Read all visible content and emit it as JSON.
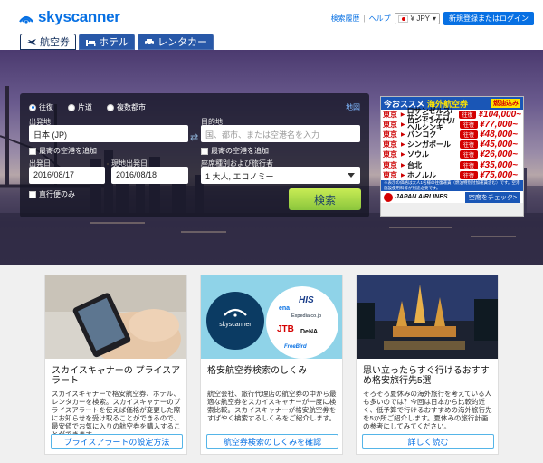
{
  "header": {
    "logo_text": "skyscanner",
    "links": {
      "history": "検索履歴",
      "help": "ヘルプ",
      "currency": "¥ JPY",
      "login": "新規登録またはログイン"
    }
  },
  "tabs": [
    {
      "label": "航空券",
      "icon": "plane-icon",
      "active": true
    },
    {
      "label": "ホテル",
      "icon": "bed-icon",
      "active": false
    },
    {
      "label": "レンタカー",
      "icon": "car-icon",
      "active": false
    }
  ],
  "search": {
    "trip_types": [
      "往復",
      "片道",
      "複数都市"
    ],
    "selected_trip": "往復",
    "map_link": "地図",
    "origin_label": "出発地",
    "origin_value": "日本 (JP)",
    "destination_label": "目的地",
    "destination_placeholder": "国、都市、または空港名を入力",
    "nearby_origin": "最寄の空港を追加",
    "nearby_destination": "最寄の空港を追加",
    "depart_label": "出発日",
    "depart_value": "2016/08/17",
    "return_label": "現地出発日",
    "return_value": "2016/08/18",
    "cabin_label": "座席種別および旅行者",
    "cabin_value": "1 大人, エコノミー",
    "direct_only": "直行便のみ",
    "search_button": "検索"
  },
  "ad": {
    "head_1": "今おススメ",
    "head_2": "海外航空券",
    "head_tag": "燃油込み",
    "fare_tag": "往復",
    "routes": [
      {
        "from": "東京",
        "dest": "ロサンゼルス/サンディエゴ",
        "price": "¥104,000~"
      },
      {
        "from": "東京",
        "dest": "ロンドン/パリ/ヘルシンキ",
        "price": "¥77,000~"
      },
      {
        "from": "東京",
        "dest": "バンコク",
        "price": "¥48,000~"
      },
      {
        "from": "東京",
        "dest": "シンガポール",
        "price": "¥45,000~"
      },
      {
        "from": "東京",
        "dest": "ソウル",
        "price": "¥26,000~"
      },
      {
        "from": "東京",
        "dest": "台北",
        "price": "¥35,000~"
      },
      {
        "from": "東京",
        "dest": "ホノルル",
        "price": "¥75,000~"
      }
    ],
    "note": "※表示の価格は大人1名様の往復運賃（燃油特別付加運賃含む）です。空港施設使用料等が別途必要です。",
    "airline": "JAPAN AIRLINES",
    "cta": "空席をチェック>"
  },
  "cards": [
    {
      "title": "スカイスキャナーの プライスアラート",
      "body": "スカイスキャナーで格安航空券、ホテル、レンタカーを検索。スカイスキャナーのプライスアラートを使えば価格が変更した際にお知らせを受け取ることができるので、最安値でお気に入りの航空券を購入することができます。",
      "button": "プライスアラートの設定方法"
    },
    {
      "title": "格安航空券検索のしくみ",
      "body": "航空会社、旅行代理店の航空券の中から最適な航空券をスカイスキャナーが一度に検索比較。スカイスキャナーが格安航空券をすばやく検索するしくみをご紹介します。",
      "button": "航空券検索のしくみを確認",
      "logos": [
        "skyscanner",
        "ena",
        "HIS",
        "Expedia.co.jp",
        "JTB",
        "DeNA",
        "FreeBird"
      ]
    },
    {
      "title": "思い立ったらすぐ行けるおすすめ格安旅行先5選",
      "body": "そろそろ夏休みの海外旅行を考えている人も多いのでは？今回は日本から比較的近く、低予算で行けるおすすめの海外旅行先を5か所ご紹介します。夏休みの旅行計画の参考にしてみてください。",
      "button": "詳しく読む"
    }
  ],
  "colors": {
    "brand": "#0770e3",
    "search_button": "#8bc63d",
    "ad_blue": "#1a56b6",
    "ad_red": "#d40000"
  }
}
